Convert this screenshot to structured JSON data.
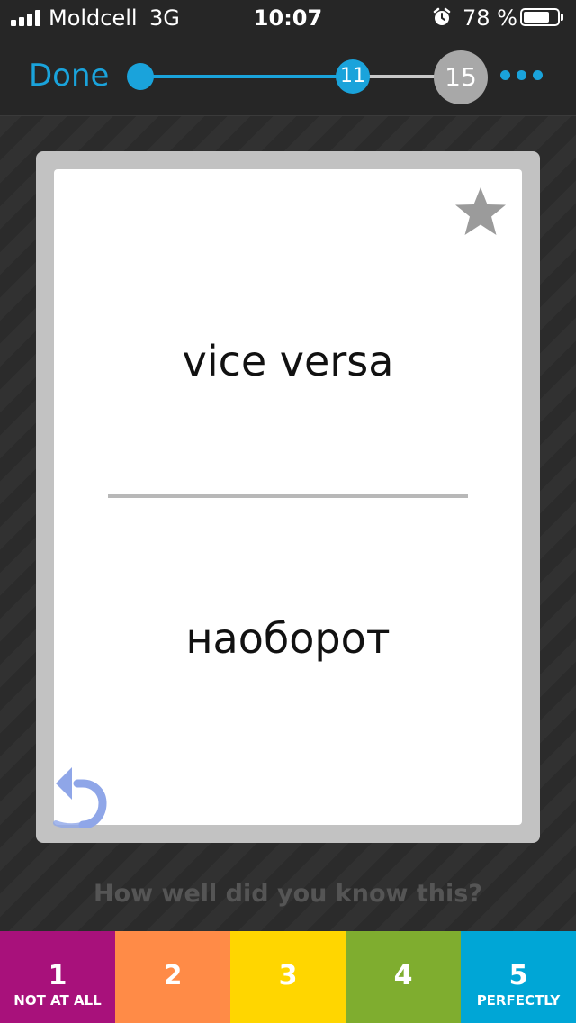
{
  "status_bar": {
    "carrier": "Moldcell",
    "network": "3G",
    "time": "10:07",
    "battery_percent": "78 %",
    "battery_level": 0.78,
    "icons": [
      "signal-icon",
      "alarm-icon",
      "battery-icon"
    ]
  },
  "nav": {
    "done_label": "Done",
    "current_card": "11",
    "total_cards": "15",
    "progress_fraction": 0.733,
    "more_icon": "more-dots-icon",
    "accent_color": "#1aa3db"
  },
  "card": {
    "term": "vice versa",
    "definition": "наоборот",
    "star_icon": "star-icon",
    "flip_icon": "flip-back-icon"
  },
  "rating": {
    "question": "How well did you know this?",
    "buttons": [
      {
        "number": "1",
        "label": "NOT AT ALL",
        "color": "#a8117b"
      },
      {
        "number": "2",
        "label": "",
        "color": "#ff8b47"
      },
      {
        "number": "3",
        "label": "",
        "color": "#ffd600"
      },
      {
        "number": "4",
        "label": "",
        "color": "#7fad2f"
      },
      {
        "number": "5",
        "label": "PERFECTLY",
        "color": "#00a6d6"
      }
    ]
  }
}
